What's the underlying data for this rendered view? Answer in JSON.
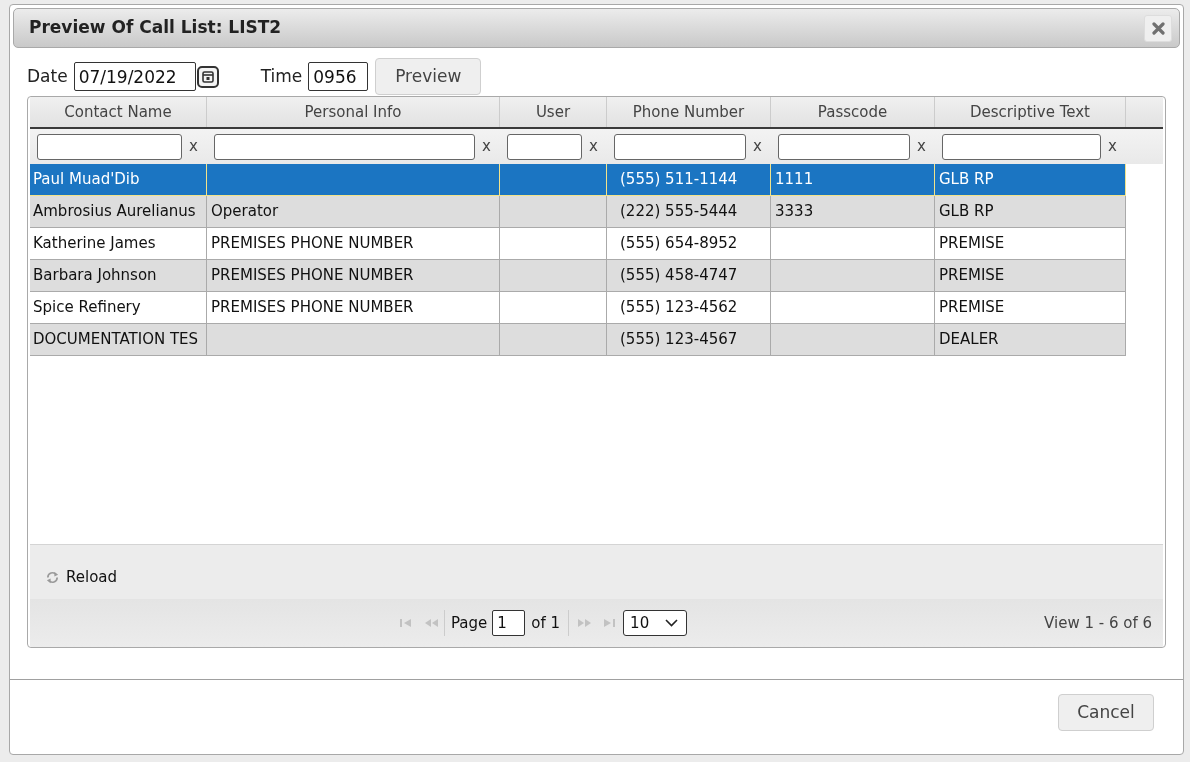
{
  "dialog": {
    "title": "Preview Of Call List: LIST2",
    "date": {
      "label": "Date",
      "value": "07/19/2022"
    },
    "time": {
      "label": "Time",
      "value": "0956"
    },
    "preview_button": "Preview",
    "grid": {
      "columns": [
        {
          "label": "Contact Name",
          "filter_clear": "x"
        },
        {
          "label": "Personal Info",
          "filter_clear": "x"
        },
        {
          "label": "User",
          "filter_clear": "x"
        },
        {
          "label": "Phone Number",
          "filter_clear": "x"
        },
        {
          "label": "Passcode",
          "filter_clear": "x"
        },
        {
          "label": "Descriptive Text",
          "filter_clear": "x"
        }
      ],
      "rows": [
        {
          "selected": true,
          "contact_name": "Paul Muad'Dib",
          "phone_number": "(555) 511-1144",
          "passcode": "1111",
          "descriptive_text": "GLB RP"
        },
        {
          "selected": false,
          "contact_name": "Ambrosius Aurelianus",
          "personal_info": "Operator",
          "phone_number": "(222) 555-5444",
          "passcode": "3333",
          "descriptive_text": "GLB RP"
        },
        {
          "selected": false,
          "contact_name": "Katherine James",
          "personal_info": "PREMISES PHONE NUMBER",
          "phone_number": "(555) 654-8952",
          "descriptive_text": "PREMISE"
        },
        {
          "selected": false,
          "contact_name": "Barbara Johnson",
          "personal_info": "PREMISES PHONE NUMBER",
          "phone_number": "(555) 458-4747",
          "descriptive_text": "PREMISE"
        },
        {
          "selected": false,
          "contact_name": "Spice Refinery",
          "personal_info": "PREMISES PHONE NUMBER",
          "phone_number": "(555) 123-4562",
          "descriptive_text": "PREMISE"
        },
        {
          "selected": false,
          "contact_name": "DOCUMENTATION TES",
          "phone_number": "(555) 123-4567",
          "descriptive_text": "DEALER"
        }
      ],
      "reload": "Reload",
      "pager": {
        "back_buttons": [
          {
            "kind": "first",
            "disabled": true
          },
          {
            "kind": "prev",
            "disabled": true
          }
        ],
        "page_label": "Page",
        "page_value": "1",
        "page_total": "of 1",
        "forward_buttons": [
          {
            "kind": "next",
            "disabled": true
          },
          {
            "kind": "last",
            "disabled": true
          }
        ],
        "page_size": "10"
      },
      "view_info": "View 1 - 6 of 6"
    },
    "cancel_button": "Cancel"
  }
}
